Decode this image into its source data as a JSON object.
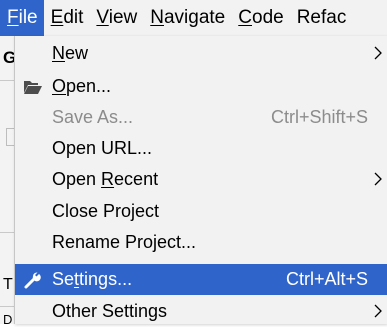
{
  "menubar": {
    "items": [
      {
        "label_u": "F",
        "label_rest": "ile"
      },
      {
        "label_u": "E",
        "label_rest": "dit"
      },
      {
        "label_u": "V",
        "label_rest": "iew"
      },
      {
        "label_u": "N",
        "label_rest": "avigate"
      },
      {
        "label_u": "C",
        "label_rest": "ode"
      },
      {
        "label_u": "",
        "label_rest": "Refac"
      }
    ]
  },
  "background": {
    "frag_top": "G",
    "frag_mid": "T",
    "frag_bottom": "D"
  },
  "file_menu": {
    "new": {
      "pre": "",
      "u": "N",
      "post": "ew"
    },
    "open": {
      "pre": "",
      "u": "O",
      "post": "pen..."
    },
    "save_as": {
      "label": "Save As...",
      "shortcut": "Ctrl+Shift+S"
    },
    "open_url": {
      "label": "Open URL..."
    },
    "open_recent": {
      "pre": "Open ",
      "u": "R",
      "post": "ecent"
    },
    "close_project": {
      "label": "Close Project"
    },
    "rename_project": {
      "label": "Rename Project..."
    },
    "settings": {
      "pre": "Se",
      "u": "t",
      "post": "tings...",
      "shortcut": "Ctrl+Alt+S"
    },
    "other_settings": {
      "label": "Other Settings"
    }
  },
  "colors": {
    "highlight": "#2f65ca",
    "menu_bg": "#f2f2f2",
    "disabled_text": "#8c8c8c"
  }
}
